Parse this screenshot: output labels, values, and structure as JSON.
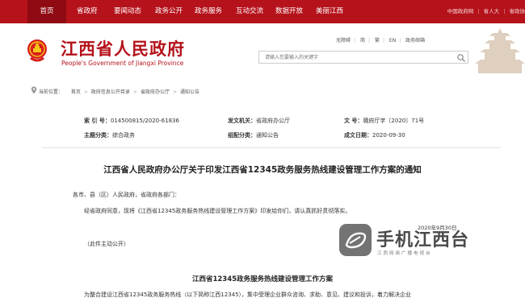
{
  "topnav": {
    "items": [
      "首页",
      "省政府",
      "要闻动态",
      "政务公开",
      "政务服务",
      "互动交流",
      "数据开放",
      "美丽江西"
    ],
    "links": [
      "中国政府网",
      "省人大",
      "省政协"
    ],
    "colors": {
      "bar": "#b5121b",
      "active": "#8f0a12"
    }
  },
  "header": {
    "title": "江西省人民政府",
    "subtitle": "People's Government of Jiangxi Province",
    "tools": [
      "无障碍",
      "简",
      "繁",
      "EN",
      "政务邮箱"
    ],
    "search_placeholder": "请输入您要输入的关键字"
  },
  "breadcrumb": {
    "prefix": "当前位置：",
    "items": [
      "首页",
      "政府信息公开目录",
      "省政府办公厅",
      "通知公告"
    ]
  },
  "meta": {
    "index_label": "索 引 号：",
    "index_value": "014500815/2020-61836",
    "issuer_label": "发文机关：",
    "issuer_value": "省政府办公厅",
    "docno_label": "文      号：",
    "docno_value": "赣府厅字〔2020〕71号",
    "topic_label": "主题分类：",
    "topic_value": "综合政务",
    "category_label": "组配分类：",
    "category_value": "通知公告",
    "date_label": "成文日期：",
    "date_value": "2020-09-30"
  },
  "article": {
    "title": "江西省人民政府办公厅关于印发江西省12345政务服务热线建设管理工作方案的通知",
    "salutation": "各市、县（区）人民政府，省政府各部门：",
    "body1": "经省政府同意，现将《江西省12345政务服务热线建设管理工作方案》印发给你们，请认真抓好贯彻落实。",
    "note": "（此件主动公开）",
    "section_title": "江西省12345政务服务热线建设管理工作方案",
    "body2": "为整合建设江西省12345政务服务热线（以下简称江西12345），集中受理企业群众咨询、求助、意见、建议和投诉，着力解决企业"
  },
  "watermark": {
    "text": "手机江西台",
    "sub": "江西网络广播电视台",
    "date": "2020年9月30日"
  }
}
